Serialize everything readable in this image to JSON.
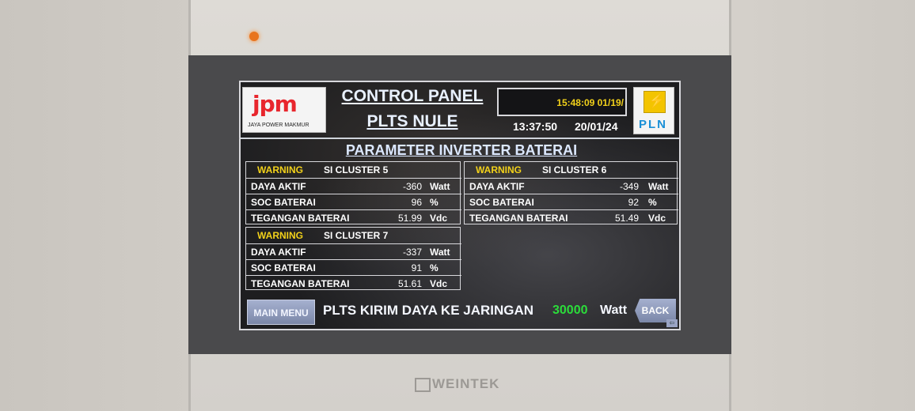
{
  "header": {
    "logo_left_mark": "jpm",
    "logo_left_text": "JAYA POWER MAKMUR",
    "title_line1": "CONTROL PANEL",
    "title_line2": "PLTS NULE",
    "clock_box_text": "15:48:09  01/19/",
    "clock_time": "13:37:50",
    "clock_date": "20/01/24",
    "logo_right_text": "PLN"
  },
  "section_title": "PARAMETER INVERTER BATERAI",
  "clusters": [
    {
      "warning": "WARNING",
      "name": "SI CLUSTER 5",
      "rows": [
        {
          "label": "DAYA AKTIF",
          "value": "-360",
          "unit": "Watt"
        },
        {
          "label": "SOC BATERAI",
          "value": "96",
          "unit": "%"
        },
        {
          "label": "TEGANGAN BATERAI",
          "value": "51.99",
          "unit": "Vdc"
        }
      ]
    },
    {
      "warning": "WARNING",
      "name": "SI CLUSTER 6",
      "rows": [
        {
          "label": "DAYA AKTIF",
          "value": "-349",
          "unit": "Watt"
        },
        {
          "label": "SOC BATERAI",
          "value": "92",
          "unit": "%"
        },
        {
          "label": "TEGANGAN BATERAI",
          "value": "51.49",
          "unit": "Vdc"
        }
      ]
    },
    {
      "warning": "WARNING",
      "name": "SI CLUSTER 7",
      "rows": [
        {
          "label": "DAYA AKTIF",
          "value": "-337",
          "unit": "Watt"
        },
        {
          "label": "SOC BATERAI",
          "value": "91",
          "unit": "%"
        },
        {
          "label": "TEGANGAN BATERAI",
          "value": "51.61",
          "unit": "Vdc"
        }
      ]
    }
  ],
  "footer": {
    "main_menu_label": "MAIN MENU",
    "status_text": "PLTS KIRIM DAYA KE JARINGAN",
    "status_value": "30000",
    "status_unit": "Watt",
    "back_label": "BACK"
  },
  "device": {
    "brand": "WEINTEK"
  },
  "colors": {
    "warning": "#f2d11a",
    "power_value": "#2bdc3a",
    "screen_bg": "#1e1e20",
    "button": "#8e99ba"
  }
}
